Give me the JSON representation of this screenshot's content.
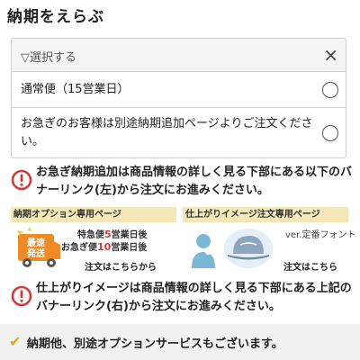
{
  "title": "納期をえらぶ",
  "select": {
    "placeholder": "▽選択する",
    "clear": "×"
  },
  "options": [
    {
      "label": "通常便（15営業日）"
    },
    {
      "label": "お急ぎのお客様は別途納期追加ページよりご注文ください。"
    }
  ],
  "notices": [
    {
      "text": "お急ぎ納期追加は商品情報の詳しく見る下部にある以下のバナーリンク(左)から注文にお進みください。"
    },
    {
      "text": "仕上がりイメージは商品情報の詳しく見る下部にある上記のバナーリンク(右)から注文にお進みください。"
    }
  ],
  "banner_left": {
    "header": "納期オプション専用ページ",
    "badge_top": "最速",
    "badge_bottom": "発送",
    "line1_prefix": "特急便",
    "line1_num": "5",
    "line1_suffix": "営業日後",
    "line2_prefix": "お急ぎ便",
    "line2_num": "10",
    "line2_suffix": "営業日後",
    "footer": "注文はこちらから"
  },
  "banner_right": {
    "header": "仕上がりイメージ注文専用ページ",
    "ver": "ver.定番フォント",
    "footer": "注文はこちら"
  },
  "footer": {
    "check": "✔",
    "text": "納期他、別途オプションサービスもございます。"
  },
  "colors": {
    "accent_red": "#d23a3a",
    "banner_header_bg": "#f4e8b8",
    "badge_orange": "#f08a24",
    "check_orange": "#e8a21c"
  }
}
